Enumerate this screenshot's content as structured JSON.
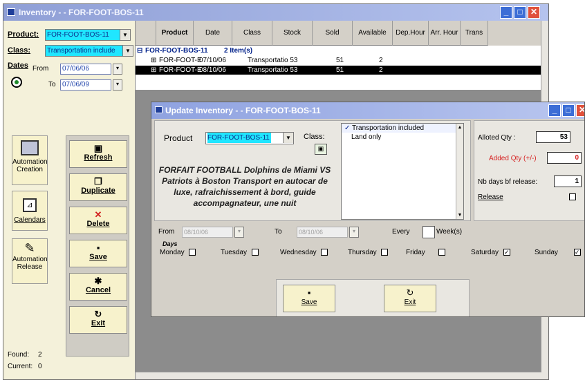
{
  "window": {
    "title": "Inventory - - FOR-FOOT-BOS-11",
    "min": "_",
    "max": "□",
    "close": "✕"
  },
  "left": {
    "product_label": "Product:",
    "product_value": "FOR-FOOT-BOS-11",
    "class_label": "Class:",
    "class_value": "Transportation include",
    "dates_label": "Dates",
    "from_label": "From",
    "from_value": "07/06/06",
    "to_label": "To",
    "to_value": "07/06/09",
    "tools": [
      {
        "label": "Automation Creation"
      },
      {
        "label": "Calendars"
      },
      {
        "label": "Automation Release"
      }
    ],
    "actions": [
      {
        "label": "Refresh"
      },
      {
        "label": "Duplicate"
      },
      {
        "label": "Delete"
      },
      {
        "label": "Save"
      },
      {
        "label": "Cancel"
      },
      {
        "label": "Exit"
      }
    ],
    "found_label": "Found:",
    "found_value": "2",
    "current_label": "Current:",
    "current_value": "0"
  },
  "grid": {
    "columns": [
      "Product",
      "Date",
      "Class",
      "Stock",
      "Sold",
      "Available",
      "Dep.Hour",
      "Arr. Hour",
      "Trans"
    ],
    "group_title": "FOR-FOOT-BOS-11",
    "group_count": "2 Item(s)",
    "rows": [
      {
        "product": "FOR-FOOT-E",
        "date": "07/10/06",
        "class": "Transportatio 53",
        "stock": "51",
        "sold": "2"
      },
      {
        "product": "FOR-FOOT-E",
        "date": "08/10/06",
        "class": "Transportatio 53",
        "stock": "51",
        "sold": "2"
      }
    ]
  },
  "dialog": {
    "title": "Update Inventory - - FOR-FOOT-BOS-11",
    "product_label": "Product",
    "product_value": "FOR-FOOT-BOS-11",
    "class_label": "Class:",
    "class_options": [
      {
        "label": "Transportation included",
        "checked": true
      },
      {
        "label": "Land only",
        "checked": false
      }
    ],
    "description": "FORFAIT FOOTBALL Dolphins de Miami VS Patriots à Boston Transport en autocar de luxe, rafraichissement à bord, guide accompagnateur, une nuit",
    "alloted_label": "Alloted Qty :",
    "alloted_value": "53",
    "added_label": "Added Qty (+/-)",
    "added_value": "0",
    "nbdays_label": "Nb days bf release:",
    "nbdays_value": "1",
    "release_label": "Release",
    "from_label": "From",
    "from_value": "08/10/06",
    "to_label": "To",
    "to_value": "08/10/06",
    "every_label": "Every",
    "weeks_label": "Week(s)",
    "days_label": "Days",
    "days": [
      {
        "label": "Monday",
        "checked": false
      },
      {
        "label": "Tuesday",
        "checked": false
      },
      {
        "label": "Wednesday",
        "checked": false
      },
      {
        "label": "Thursday",
        "checked": false
      },
      {
        "label": "Friday",
        "checked": false
      },
      {
        "label": "Saturday",
        "checked": true
      },
      {
        "label": "Sunday",
        "checked": true
      }
    ],
    "save_label": "Save",
    "exit_label": "Exit"
  },
  "colors": {
    "accent_cyan": "#20e6ff",
    "button_face": "#f7f2cc",
    "title_blue": "#8f9fd6"
  }
}
